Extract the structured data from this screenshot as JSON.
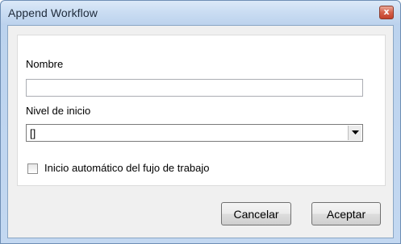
{
  "window": {
    "title": "Append Workflow",
    "close_glyph": "x"
  },
  "form": {
    "name_label": "Nombre",
    "name_value": "",
    "level_label": "Nivel de inicio",
    "level_value": "[]",
    "autostart_label": "Inicio automático del fujo de trabajo",
    "autostart_checked": false
  },
  "buttons": {
    "cancel_label": "Cancelar",
    "accept_label": "Aceptar"
  },
  "icons": {
    "close": "close-icon",
    "dropdown": "chevron-down-icon"
  }
}
